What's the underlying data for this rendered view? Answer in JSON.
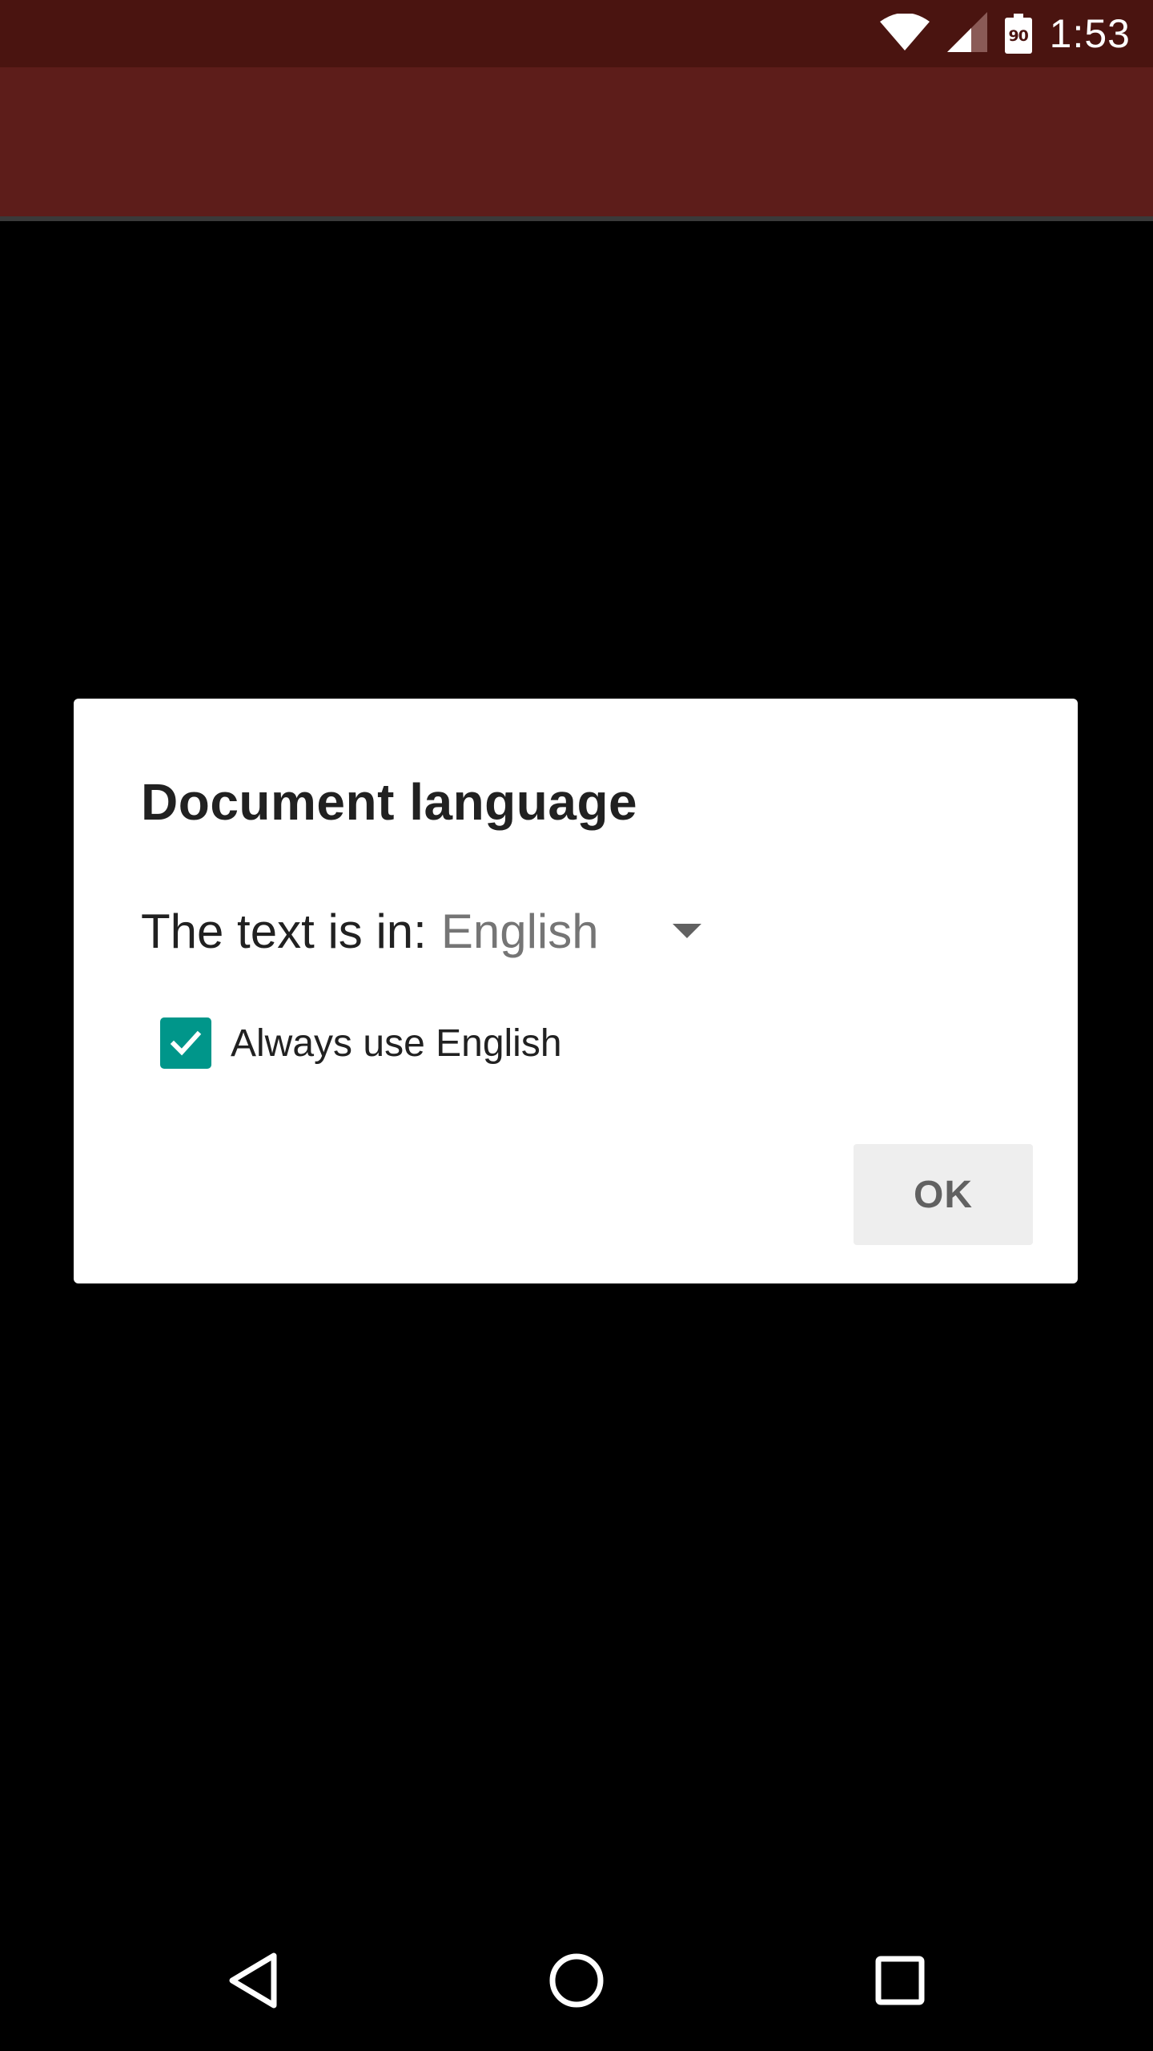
{
  "status_bar": {
    "time": "1:53",
    "battery_level": "90",
    "icons": [
      "wifi-icon",
      "cell-signal-icon",
      "battery-icon"
    ]
  },
  "dialog": {
    "title": "Document language",
    "language_label": "The text is in:",
    "language_value": "English",
    "checkbox_label": "Always use English",
    "checkbox_checked": true,
    "ok_label": "OK"
  },
  "nav_bar": {
    "icons": [
      "back-icon",
      "home-icon",
      "recents-icon"
    ]
  },
  "colors": {
    "status_bar": "#4a1410",
    "app_bar": "#5d1d1a",
    "accent": "#00968a",
    "background": "#000000"
  }
}
